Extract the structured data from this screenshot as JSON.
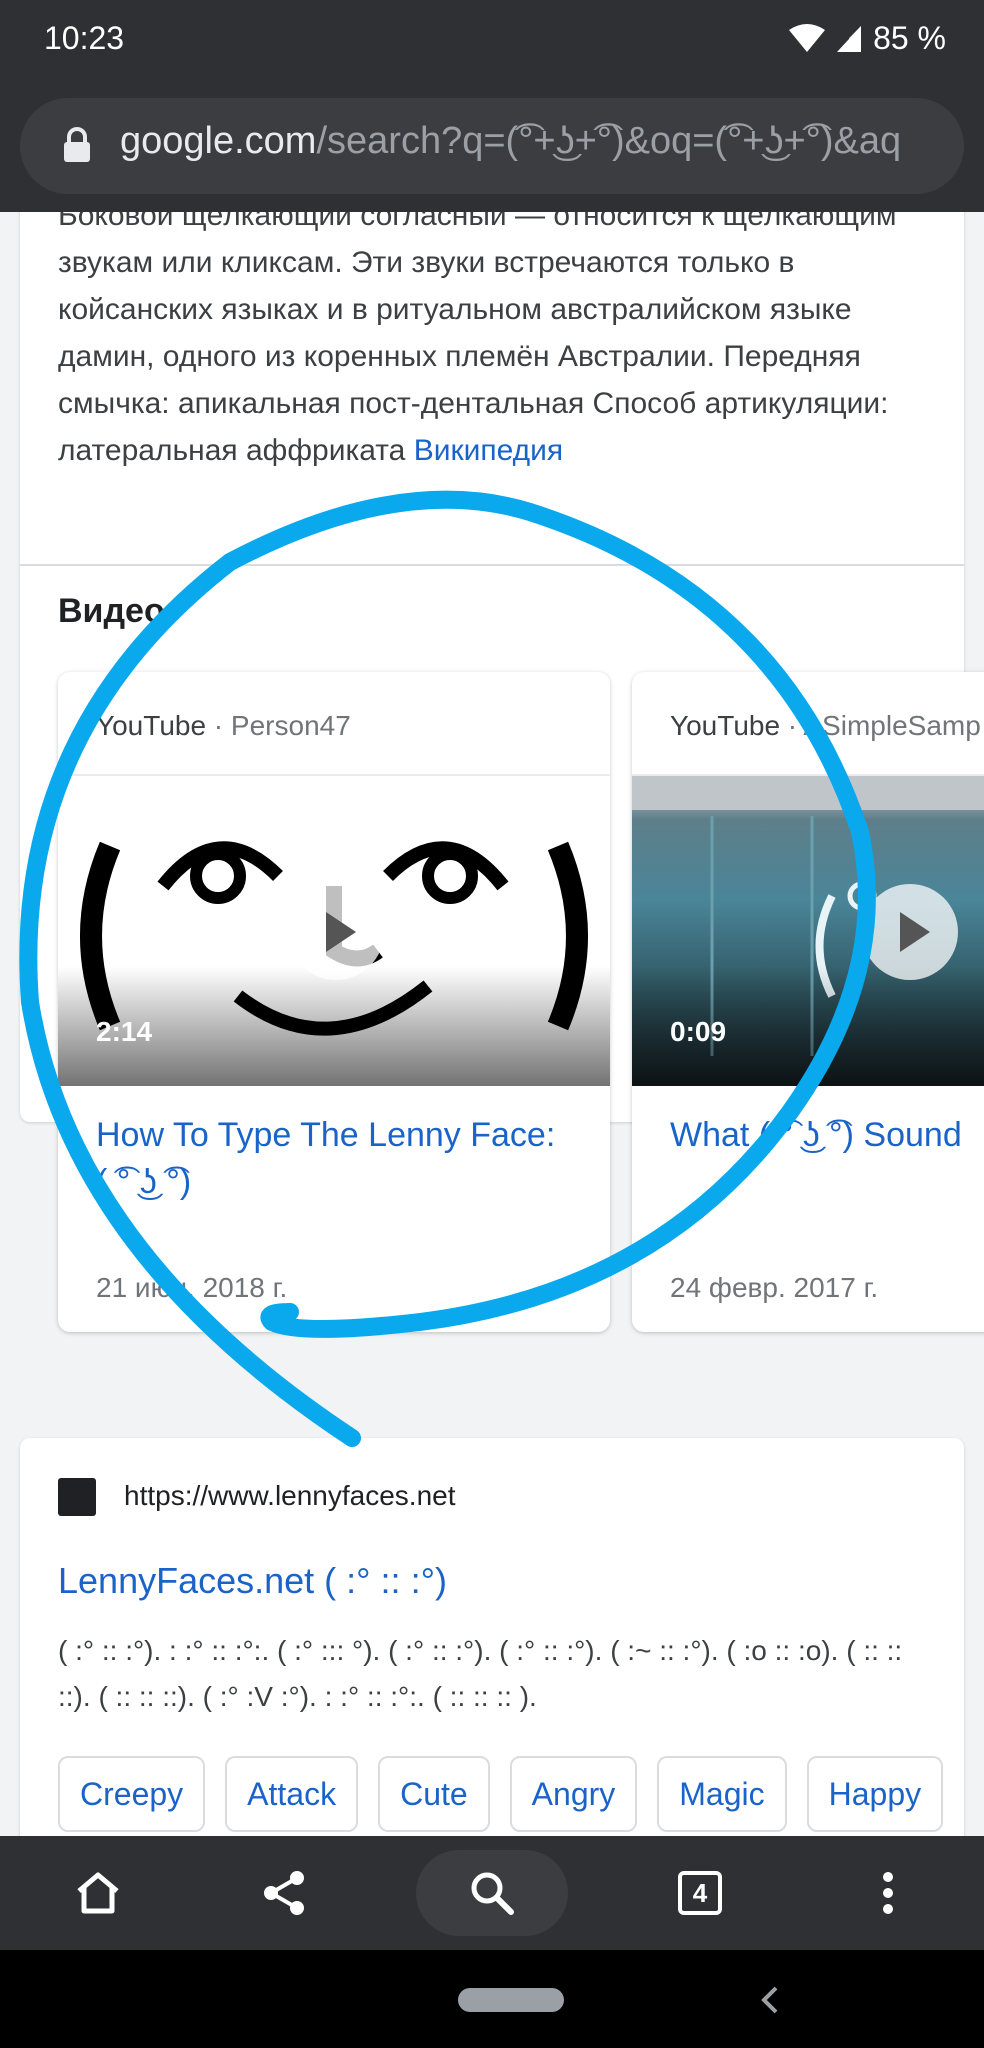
{
  "status_bar": {
    "time": "10:23",
    "battery": "85 %"
  },
  "address_bar": {
    "domain": "google.com",
    "path": "/search?q=(͡°+͜ʖ+͡°)&oq=(͡°+͜ʖ+͡°)&aq"
  },
  "knowledge_panel": {
    "snippet": "Боковой щёлкающий согласный — относится к щёлкающим звукам или кликсам. Эти звуки встречаются только в койсанских языках и в ритуальном австралийском языке дамин, одного из коренных племён Австралии. Передняя смычка: апикальная пост-дентальная Способ артикуляции: латеральная аффриката",
    "source_link": "Википедия"
  },
  "videos": {
    "heading": "Видео",
    "items": [
      {
        "source": "YouTube",
        "channel": "Person47",
        "duration": "2:14",
        "title": "How To Type The Lenny Face:( ͡° ͜ʖ ͡°)",
        "date": "21 июн. 2018 г."
      },
      {
        "source": "YouTube",
        "channel": "ASimpleSamp",
        "duration": "0:09",
        "title": "What ( ͡° ͜ʖ ͡°) Sound",
        "date": "24 февр. 2017 г."
      }
    ]
  },
  "result": {
    "url": "https://www.lennyfaces.net",
    "title": "LennyFaces.net ( :° :: :°)",
    "snippet": "( :° :: :°). : :° :: :°:. ( :° ::: °). ( :° :: :°). ( :° :: :°). ( :~ :: :°). ( :o :: :o). ( :: :: ::). ( :: :: ::). ( :° :V :°). : :° :: :°:. ( :: :: :: ).",
    "chips": [
      "Creepy",
      "Attack",
      "Cute",
      "Angry",
      "Magic",
      "Happy"
    ]
  },
  "toolbar": {
    "tab_count": "4"
  },
  "colors": {
    "link": "#1a63c8",
    "annotation": "#0aa8ec",
    "chrome_dark": "#2f3033"
  }
}
